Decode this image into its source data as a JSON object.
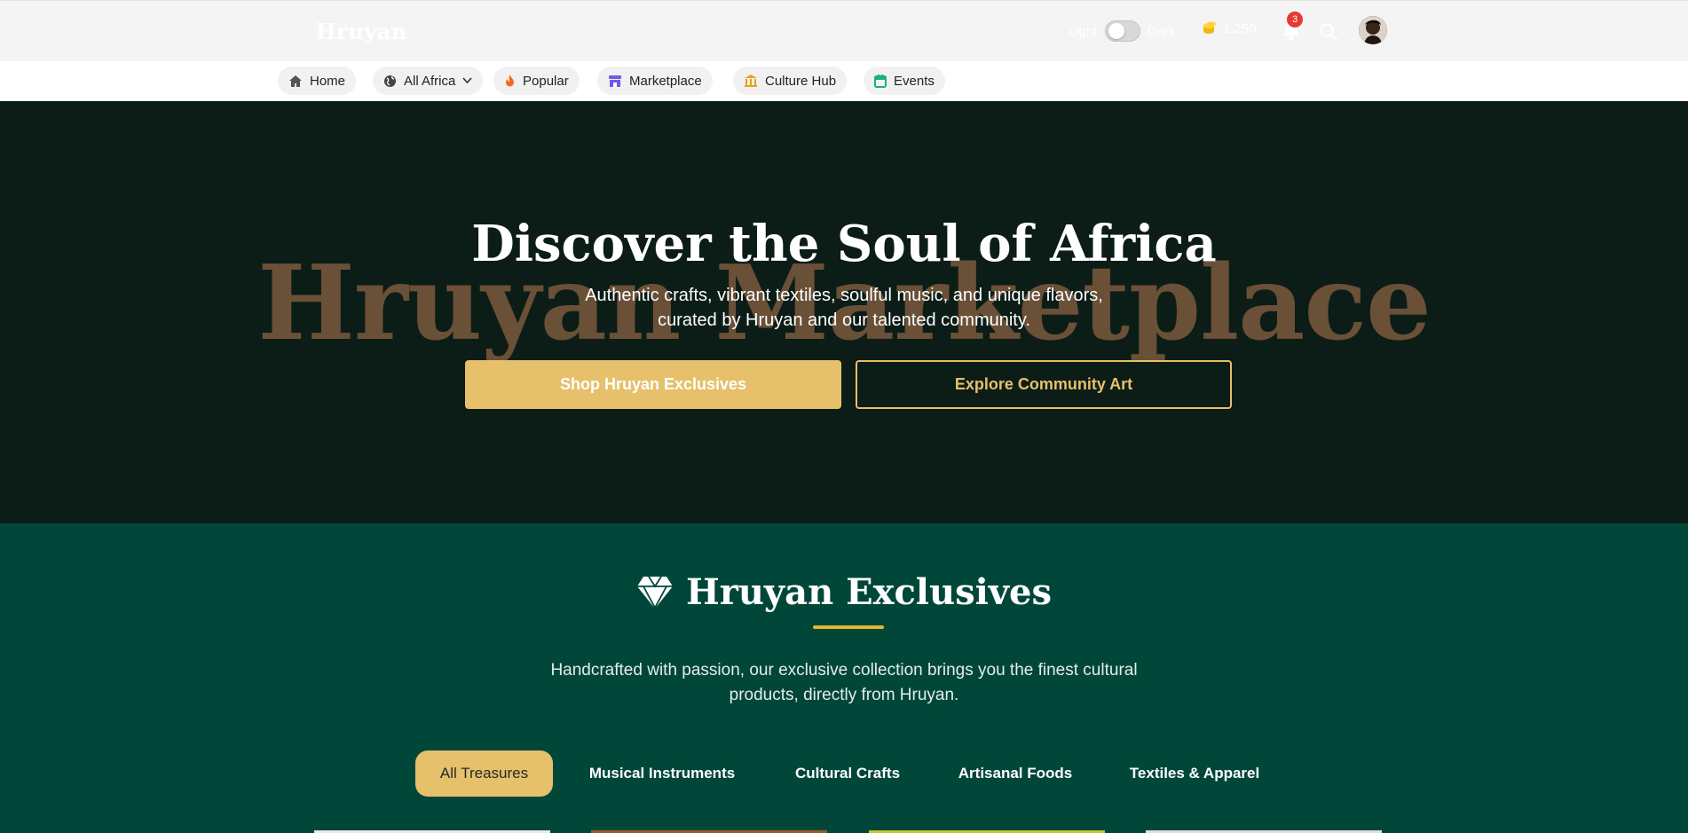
{
  "header": {
    "brand": "Hruyan",
    "theme_light_label": "Light",
    "theme_dark_label": "Dark",
    "coins": "1,250",
    "notification_count": "3"
  },
  "nav": {
    "items": [
      {
        "label": "Home",
        "icon": "home-icon"
      },
      {
        "label": "All Africa",
        "icon": "globe-icon"
      },
      {
        "label": "Popular",
        "icon": "flame-icon"
      },
      {
        "label": "Marketplace",
        "icon": "store-icon"
      },
      {
        "label": "Culture Hub",
        "icon": "landmark-icon"
      },
      {
        "label": "Events",
        "icon": "calendar-icon"
      }
    ]
  },
  "hero": {
    "watermark": "Hruyan Marketplace",
    "title": "Discover the Soul of Africa",
    "subtitle_line1": "Authentic crafts, vibrant textiles, soulful music, and unique flavors,",
    "subtitle_line2": "curated by Hruyan and our talented community.",
    "primary_cta": "Shop Hruyan Exclusives",
    "secondary_cta": "Explore Community Art"
  },
  "exclusives": {
    "title": "Hruyan Exclusives",
    "description_line1": "Handcrafted with passion, our exclusive collection brings you the finest cultural",
    "description_line2": "products, directly from Hruyan.",
    "tabs": [
      "All Treasures",
      "Musical Instruments",
      "Cultural Crafts",
      "Artisanal Foods",
      "Textiles & Apparel"
    ],
    "active_tab": "All Treasures"
  },
  "colors": {
    "accent_gold": "#e6c06a",
    "hero_bg": "#0c1d17",
    "exclusives_bg": "#00473a",
    "watermark": "#6a5037"
  }
}
